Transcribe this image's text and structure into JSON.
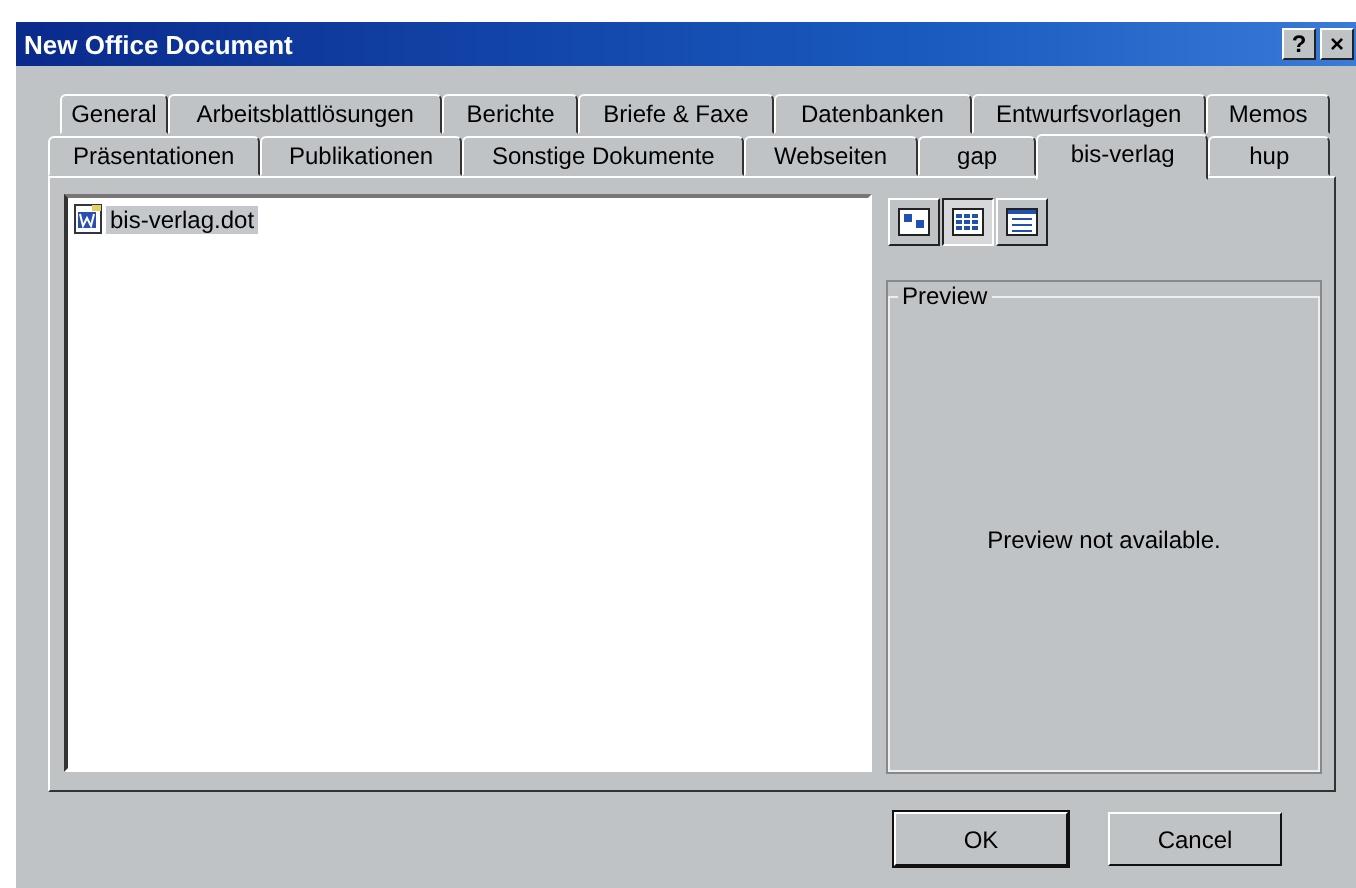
{
  "window": {
    "title": "New Office Document",
    "help_button": "?",
    "close_button": "×"
  },
  "tab_rows": [
    [
      {
        "label": "General",
        "selected": false
      },
      {
        "label": "Arbeitsblattlösungen",
        "selected": false
      },
      {
        "label": "Berichte",
        "selected": false
      },
      {
        "label": "Briefe & Faxe",
        "selected": false
      },
      {
        "label": "Datenbanken",
        "selected": false
      },
      {
        "label": "Entwurfsvorlagen",
        "selected": false
      },
      {
        "label": "Memos",
        "selected": false
      }
    ],
    [
      {
        "label": "Präsentationen",
        "selected": false
      },
      {
        "label": "Publikationen",
        "selected": false
      },
      {
        "label": "Sonstige Dokumente",
        "selected": false
      },
      {
        "label": "Webseiten",
        "selected": false
      },
      {
        "label": "gap",
        "selected": false
      },
      {
        "label": "bis-verlag",
        "selected": true
      },
      {
        "label": "hup",
        "selected": false
      }
    ]
  ],
  "files": [
    {
      "name": "bis-verlag.dot",
      "selected": true
    }
  ],
  "view_buttons": [
    {
      "kind": "large",
      "selected": false
    },
    {
      "kind": "list",
      "selected": true
    },
    {
      "kind": "details",
      "selected": false
    }
  ],
  "preview": {
    "title": "Preview",
    "message": "Preview not available."
  },
  "buttons": [
    "OK",
    "Cancel"
  ]
}
